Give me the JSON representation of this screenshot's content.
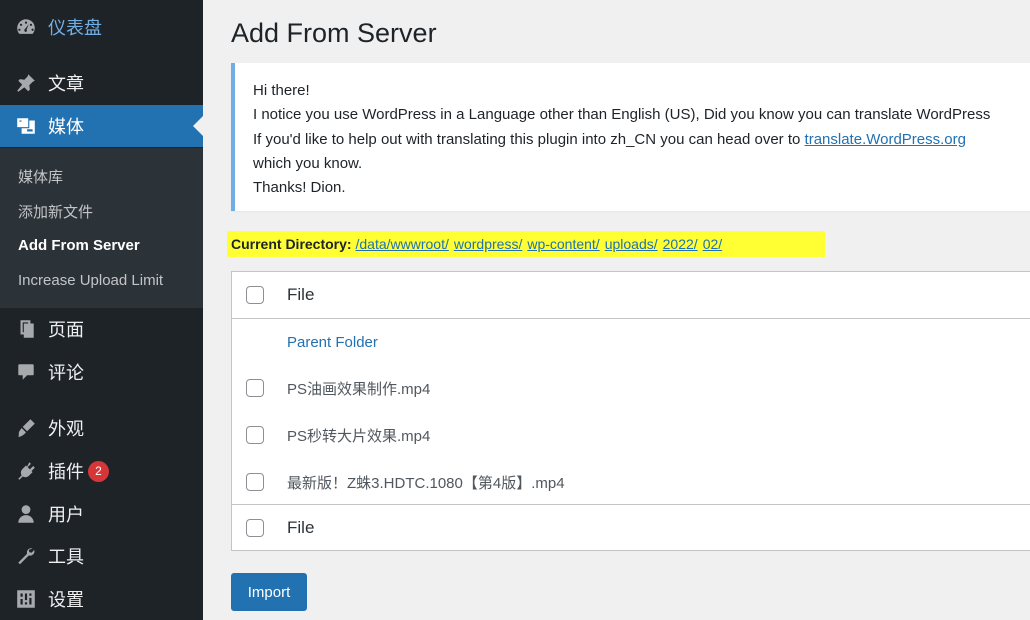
{
  "sidebar": {
    "dashboard": "仪表盘",
    "posts": "文章",
    "media": "媒体",
    "submenu": [
      "媒体库",
      "添加新文件",
      "Add From Server",
      "Increase Upload Limit"
    ],
    "pages": "页面",
    "comments": "评论",
    "appearance": "外观",
    "plugins": "插件",
    "plugins_badge": "2",
    "users": "用户",
    "tools": "工具",
    "settings": "设置"
  },
  "main": {
    "title": "Add From Server",
    "notice": {
      "line1": "Hi there!",
      "line2": "I notice you use WordPress in a Language other than English (US), Did you know you can translate WordPress",
      "line3_prefix": "If you'd like to help out with translating this plugin into zh_CN you can head over to ",
      "line3_link": "translate.WordPress.org",
      "line4": "which you know.",
      "line5": "Thanks! Dion."
    },
    "current_directory": {
      "label": "Current Directory:",
      "segments": [
        "/data/wwwroot/",
        "wordpress/",
        "wp-content/",
        "uploads/",
        "2022/",
        "02/"
      ]
    },
    "table": {
      "header": "File",
      "parent_folder": "Parent Folder",
      "files": [
        "PS油画效果制作.mp4",
        "PS秒转大片效果.mp4",
        "最新版！Z蛛3.HDTC.1080【第4版】.mp4"
      ],
      "footer": "File"
    },
    "import_label": "Import"
  },
  "colors": {
    "sidebar_bg": "#1d2327",
    "accent": "#2271b1",
    "highlight": "#ffff33",
    "badge": "#d63638"
  }
}
